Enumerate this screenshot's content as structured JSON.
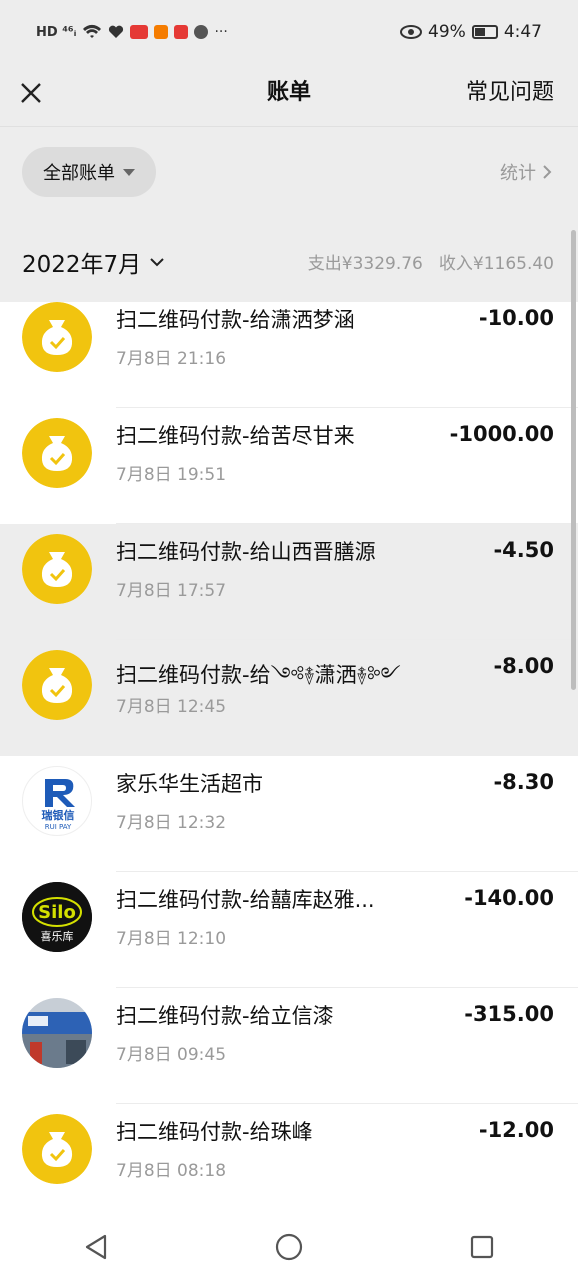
{
  "status_bar": {
    "left_text": "HD ⁴⁶ᵢ",
    "more": "···",
    "battery": "49%",
    "time": "4:47"
  },
  "nav": {
    "title": "账单",
    "faq": "常见问题"
  },
  "filter": {
    "label": "全部账单",
    "stats": "统计"
  },
  "month": {
    "label": "2022年7月",
    "expense": "支出¥3329.76",
    "income": "收入¥1165.40"
  },
  "transactions": [
    {
      "title": "扫二维码付款-给潇洒梦涵",
      "time": "7月8日 21:16",
      "amount": "-10.00",
      "avatar": "wechat-pay-bag"
    },
    {
      "title": "扫二维码付款-给苦尽甘来",
      "time": "7月8日 19:51",
      "amount": "-1000.00",
      "avatar": "wechat-pay-bag"
    },
    {
      "title": "扫二维码付款-给山西晋膳源",
      "time": "7月8日 17:57",
      "amount": "-4.50",
      "avatar": "wechat-pay-bag"
    },
    {
      "title": "扫二维码付款-给༺࿈潇洒࿈༻",
      "time": "7月8日 12:45",
      "amount": "-8.00",
      "avatar": "wechat-pay-bag"
    },
    {
      "title": "家乐华生活超市",
      "time": "7月8日 12:32",
      "amount": "-8.30",
      "avatar": "ruiyinxin-logo",
      "logo_text": "瑞银信",
      "logo_sub": "RUI PAY"
    },
    {
      "title": "扫二维码付款-给囍库赵雅...",
      "time": "7月8日 12:10",
      "amount": "-140.00",
      "avatar": "silo-logo",
      "logo_text": "Silo",
      "logo_sub": "喜乐库"
    },
    {
      "title": "扫二维码付款-给立信漆",
      "time": "7月8日 09:45",
      "amount": "-315.00",
      "avatar": "store-photo"
    },
    {
      "title": "扫二维码付款-给珠峰",
      "time": "7月8日 08:18",
      "amount": "-12.00",
      "avatar": "wechat-pay-bag"
    }
  ],
  "colors": {
    "bag_yellow": "#f1c40f",
    "background": "#ededed",
    "muted": "#9a9a9a"
  }
}
